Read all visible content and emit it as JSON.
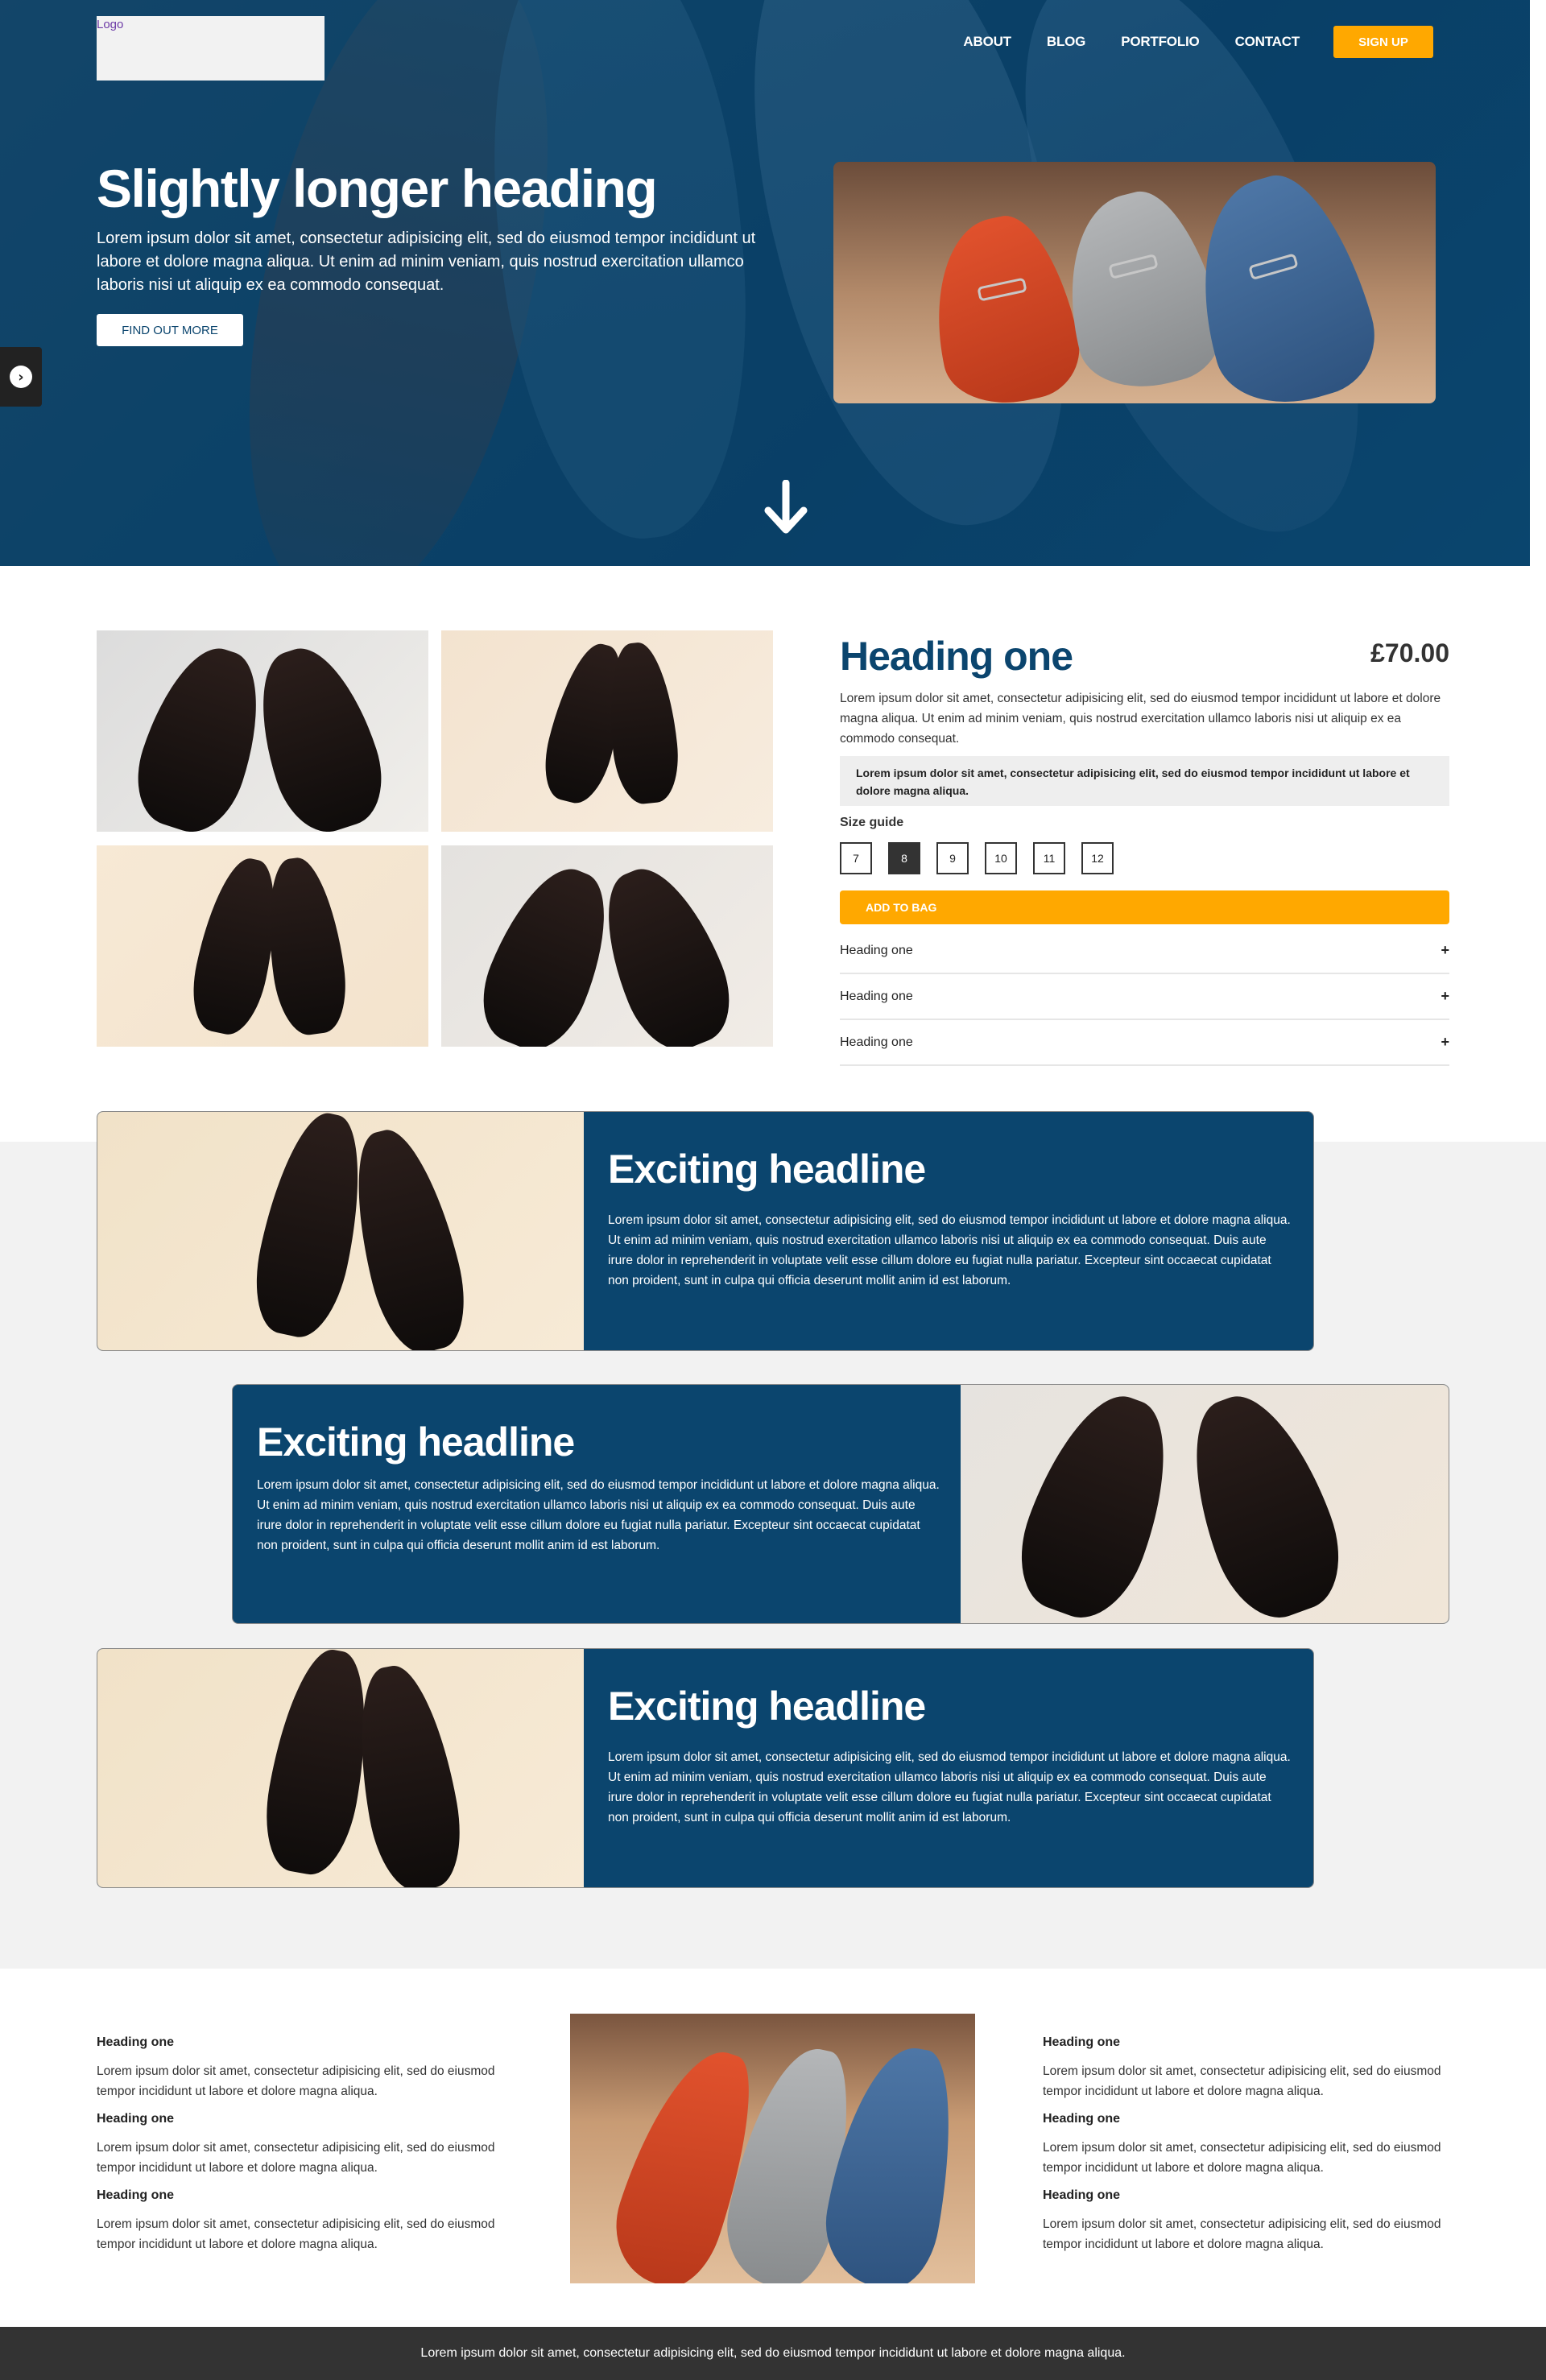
{
  "header": {
    "logo_text": "Logo",
    "nav": [
      "ABOUT",
      "BLOG",
      "PORTFOLIO",
      "CONTACT"
    ],
    "signup_label": "SIGN UP"
  },
  "hero": {
    "title": "Slightly longer heading",
    "text": "Lorem ipsum dolor sit amet, consectetur adipisicing elit, sed do eiusmod tempor incididunt ut labore et dolore magna aliqua. Ut enim ad minim veniam, quis nostrud exercitation ullamco laboris nisi ut aliquip ex ea commodo consequat.",
    "button_label": "FIND OUT MORE"
  },
  "product": {
    "title": "Heading one",
    "price": "£70.00",
    "description": "Lorem ipsum dolor sit amet, consectetur adipisicing elit, sed do eiusmod tempor incididunt ut labore et dolore magna aliqua. Ut enim ad minim veniam, quis nostrud exercitation ullamco laboris nisi ut aliquip ex ea commodo consequat.",
    "note": "Lorem ipsum dolor sit amet, consectetur adipisicing elit, sed do eiusmod tempor incididunt ut labore et dolore magna aliqua.",
    "size_label": "Size guide",
    "sizes": [
      "7",
      "8",
      "9",
      "10",
      "11",
      "12"
    ],
    "selected_size": "8",
    "add_label": "ADD TO BAG",
    "accordion": [
      "Heading one",
      "Heading one",
      "Heading one"
    ],
    "accordion_icon": "+"
  },
  "features": [
    {
      "headline": "Exciting headline",
      "text": "Lorem ipsum dolor sit amet, consectetur adipisicing elit, sed do eiusmod tempor incididunt ut labore et dolore magna aliqua. Ut enim ad minim veniam, quis nostrud exercitation ullamco laboris nisi ut aliquip ex ea commodo consequat. Duis aute irure dolor in reprehenderit in voluptate velit esse cillum dolore eu fugiat nulla pariatur. Excepteur sint occaecat cupidatat non proident, sunt in culpa qui officia deserunt mollit anim id est laborum."
    },
    {
      "headline": "Exciting headline",
      "text": "Lorem ipsum dolor sit amet, consectetur adipisicing elit, sed do eiusmod tempor incididunt ut labore et dolore magna aliqua. Ut enim ad minim veniam, quis nostrud exercitation ullamco laboris nisi ut aliquip ex ea commodo consequat. Duis aute irure dolor in reprehenderit in voluptate velit esse cillum dolore eu fugiat nulla pariatur. Excepteur sint occaecat cupidatat non proident, sunt in culpa qui officia deserunt mollit anim id est laborum."
    },
    {
      "headline": "Exciting headline",
      "text": "Lorem ipsum dolor sit amet, consectetur adipisicing elit, sed do eiusmod tempor incididunt ut labore et dolore magna aliqua. Ut enim ad minim veniam, quis nostrud exercitation ullamco laboris nisi ut aliquip ex ea commodo consequat. Duis aute irure dolor in reprehenderit in voluptate velit esse cillum dolore eu fugiat nulla pariatur. Excepteur sint occaecat cupidatat non proident, sunt in culpa qui officia deserunt mollit anim id est laborum."
    }
  ],
  "bottom": {
    "left": [
      {
        "heading": "Heading one",
        "text": "Lorem ipsum dolor sit amet, consectetur adipisicing elit, sed do eiusmod tempor incididunt ut labore et dolore magna aliqua."
      },
      {
        "heading": "Heading one",
        "text": "Lorem ipsum dolor sit amet, consectetur adipisicing elit, sed do eiusmod tempor incididunt ut labore et dolore magna aliqua."
      },
      {
        "heading": "Heading one",
        "text": "Lorem ipsum dolor sit amet, consectetur adipisicing elit, sed do eiusmod tempor incididunt ut labore et dolore magna aliqua."
      }
    ],
    "right": [
      {
        "heading": "Heading one",
        "text": "Lorem ipsum dolor sit amet, consectetur adipisicing elit, sed do eiusmod tempor incididunt ut labore et dolore magna aliqua."
      },
      {
        "heading": "Heading one",
        "text": "Lorem ipsum dolor sit amet, consectetur adipisicing elit, sed do eiusmod tempor incididunt ut labore et dolore magna aliqua."
      },
      {
        "heading": "Heading one",
        "text": "Lorem ipsum dolor sit amet, consectetur adipisicing elit, sed do eiusmod tempor incididunt ut labore et dolore magna aliqua."
      }
    ]
  },
  "footer": {
    "text": "Lorem ipsum dolor sit amet, consectetur adipisicing elit, sed do eiusmod tempor incididunt ut labore et dolore magna aliqua."
  },
  "colors": {
    "brand_blue": "#0b456e",
    "accent_orange": "#ffa800",
    "footer_bg": "#333333",
    "band_bg": "#f2f2f2"
  },
  "icons": {
    "side_tab": "chevron-right-circle-icon",
    "scroll": "arrow-down-icon"
  }
}
